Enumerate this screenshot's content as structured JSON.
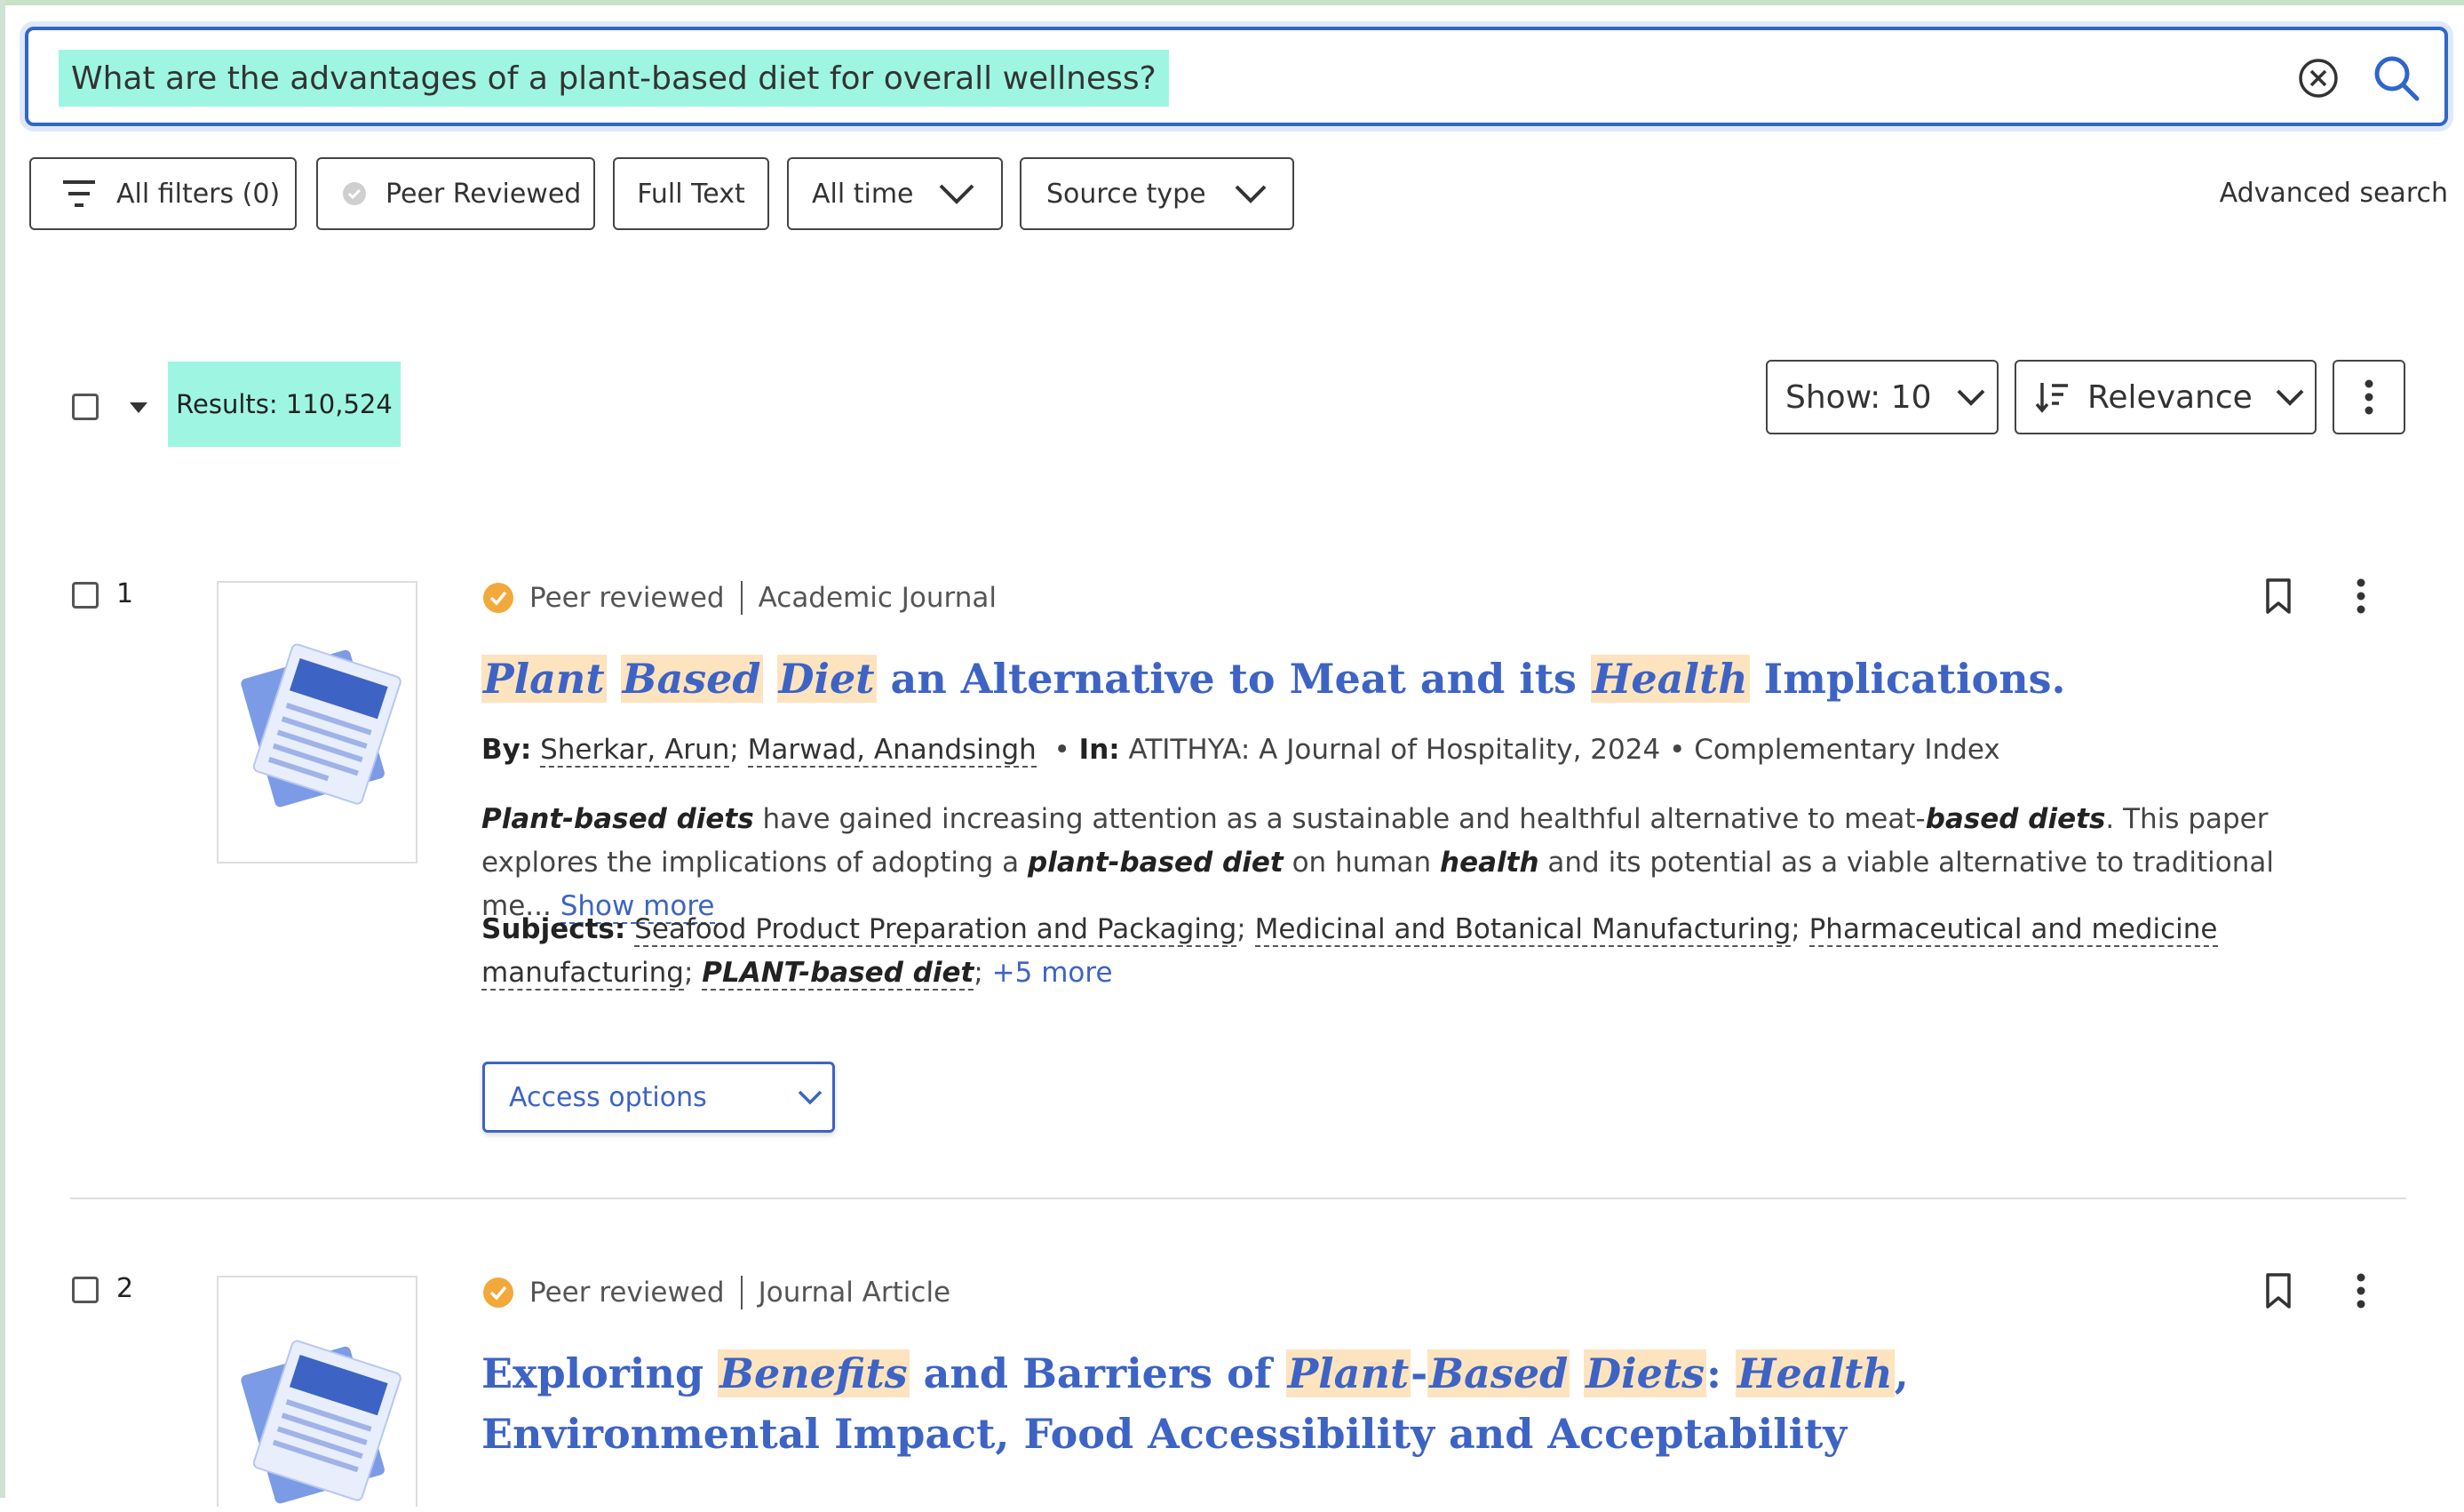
{
  "search": {
    "query": "What are the advantages of a plant-based diet for overall wellness?",
    "clear_icon": "close-circle-icon",
    "search_icon": "search-icon"
  },
  "filters": {
    "all_filters": "All filters (0)",
    "peer_reviewed": "Peer Reviewed",
    "full_text": "Full Text",
    "all_time": "All time",
    "source_type": "Source type",
    "advanced_search": "Advanced search"
  },
  "results_header": {
    "count_label": "Results: 110,524",
    "show_label": "Show: 10",
    "sort_label": "Relevance"
  },
  "colors": {
    "accent_blue": "#3d63c5",
    "search_highlight": "#9ef6e2",
    "term_highlight": "#fde4bf",
    "peer_badge": "#f2a93b"
  },
  "results": [
    {
      "number": "1",
      "peer": "Peer reviewed",
      "type": "Academic Journal",
      "title": {
        "t1": "Plant",
        "t2": " ",
        "t3": "Based",
        "t4": " ",
        "t5": "Diet",
        "t6": " an Alternative to Meat and its ",
        "t7": "Health",
        "t8": " Implications."
      },
      "by_label": "By:",
      "author1": "Sherkar, Arun",
      "author2": "Marwad, Anandsingh",
      "in_label": "In:",
      "source": "ATITHYA: A Journal of Hospitality, 2024",
      "database": "Complementary Index",
      "abstract": {
        "a1": "Plant-based diets",
        "a2": " have gained increasing attention as a sustainable and healthful alternative to meat-",
        "a3": "based diets",
        "a4": ". This paper explores the implications of adopting a ",
        "a5": "plant-based diet",
        "a6": " on human ",
        "a7": "health",
        "a8": " and its potential as a viable alternative to traditional me... ",
        "show_more": "Show more"
      },
      "subjects_label": "Subjects:",
      "subject1": "Seafood Product Preparation and Packaging",
      "subject2": "Medicinal and Botanical Manufacturing",
      "subject3": "Pharmaceutical and medicine manufacturing",
      "subject4": "PLANT-based diet",
      "more_subjects": "+5 more",
      "access_label": "Access options"
    },
    {
      "number": "2",
      "peer": "Peer reviewed",
      "type": "Journal Article",
      "title": {
        "t1": "Exploring ",
        "t2": "Benefits",
        "t3": " and Barriers of ",
        "t4": "Plant",
        "t5": "-",
        "t6": "Based",
        "t7": " ",
        "t8": "Diets",
        "t9": ": ",
        "t10": "Health",
        "t11": ", Environmental Impact, Food Accessibility and Acceptability"
      }
    }
  ]
}
